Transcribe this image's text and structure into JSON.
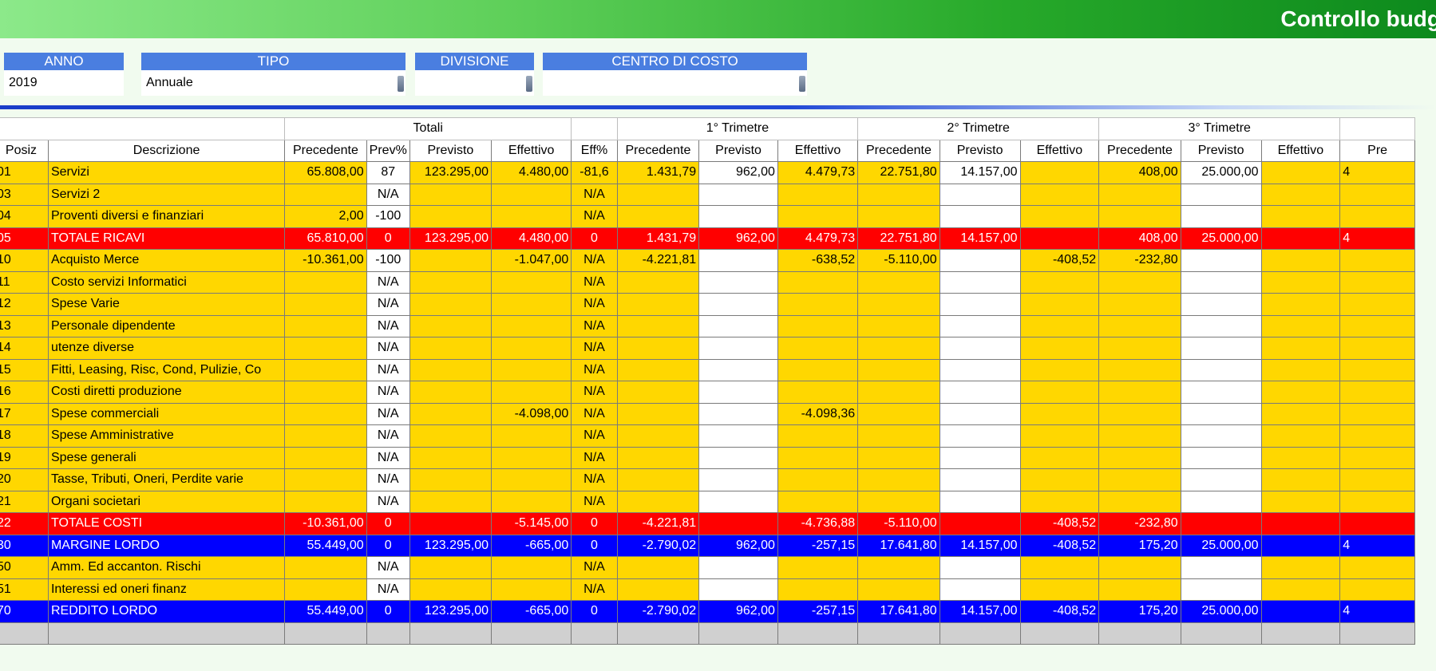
{
  "title": "Controllo budg",
  "filters": [
    {
      "label": "ANNO",
      "value": "2019"
    },
    {
      "label": "TIPO",
      "value": "Annuale"
    },
    {
      "label": "DIVISIONE",
      "value": ""
    },
    {
      "label": "CENTRO DI COSTO",
      "value": ""
    }
  ],
  "groups": [
    "Totali",
    "1° Trimetre",
    "2° Trimetre",
    "3° Trimetre"
  ],
  "columns": [
    "Posiz",
    "Descrizione",
    "Precedente",
    "Prev%",
    "Previsto",
    "Effettivo",
    "Eff%",
    "Precedente",
    "Previsto",
    "Effettivo",
    "Precedente",
    "Previsto",
    "Effettivo",
    "Precedente",
    "Previsto",
    "Effettivo",
    "Pre"
  ],
  "rows": [
    {
      "type": "yel",
      "cells": [
        "01",
        "Servizi",
        "65.808,00",
        "87",
        "123.295,00",
        "4.480,00",
        "-81,6",
        "1.431,79",
        "962,00",
        "4.479,73",
        "22.751,80",
        "14.157,00",
        "",
        "408,00",
        "25.000,00",
        "",
        "4"
      ]
    },
    {
      "type": "yel",
      "cells": [
        "03",
        "Servizi 2",
        "",
        "N/A",
        "",
        "",
        "N/A",
        "",
        "",
        "",
        "",
        "",
        "",
        "",
        "",
        "",
        ""
      ]
    },
    {
      "type": "yel",
      "cells": [
        "04",
        "Proventi diversi e finanziari",
        "2,00",
        "-100",
        "",
        "",
        "N/A",
        "",
        "",
        "",
        "",
        "",
        "",
        "",
        "",
        "",
        ""
      ]
    },
    {
      "type": "red",
      "cells": [
        "05",
        "TOTALE RICAVI",
        "65.810,00",
        "0",
        "123.295,00",
        "4.480,00",
        "0",
        "1.431,79",
        "962,00",
        "4.479,73",
        "22.751,80",
        "14.157,00",
        "",
        "408,00",
        "25.000,00",
        "",
        "4"
      ]
    },
    {
      "type": "yel",
      "cells": [
        "10",
        "Acquisto Merce",
        "-10.361,00",
        "-100",
        "",
        "-1.047,00",
        "N/A",
        "-4.221,81",
        "",
        "-638,52",
        "-5.110,00",
        "",
        "-408,52",
        "-232,80",
        "",
        "",
        ""
      ]
    },
    {
      "type": "yel",
      "cells": [
        "11",
        "Costo servizi Informatici",
        "",
        "N/A",
        "",
        "",
        "N/A",
        "",
        "",
        "",
        "",
        "",
        "",
        "",
        "",
        "",
        ""
      ]
    },
    {
      "type": "yel",
      "cells": [
        "12",
        "Spese Varie",
        "",
        "N/A",
        "",
        "",
        "N/A",
        "",
        "",
        "",
        "",
        "",
        "",
        "",
        "",
        "",
        ""
      ]
    },
    {
      "type": "yel",
      "cells": [
        "13",
        "Personale dipendente",
        "",
        "N/A",
        "",
        "",
        "N/A",
        "",
        "",
        "",
        "",
        "",
        "",
        "",
        "",
        "",
        ""
      ]
    },
    {
      "type": "yel",
      "cells": [
        "14",
        "utenze diverse",
        "",
        "N/A",
        "",
        "",
        "N/A",
        "",
        "",
        "",
        "",
        "",
        "",
        "",
        "",
        "",
        ""
      ]
    },
    {
      "type": "yel",
      "cells": [
        "15",
        "Fitti, Leasing, Risc, Cond, Pulizie, Co",
        "",
        "N/A",
        "",
        "",
        "N/A",
        "",
        "",
        "",
        "",
        "",
        "",
        "",
        "",
        "",
        ""
      ]
    },
    {
      "type": "yel",
      "cells": [
        "16",
        "Costi diretti produzione",
        "",
        "N/A",
        "",
        "",
        "N/A",
        "",
        "",
        "",
        "",
        "",
        "",
        "",
        "",
        "",
        ""
      ]
    },
    {
      "type": "yel",
      "cells": [
        "17",
        "Spese commerciali",
        "",
        "N/A",
        "",
        "-4.098,00",
        "N/A",
        "",
        "",
        "-4.098,36",
        "",
        "",
        "",
        "",
        "",
        "",
        ""
      ]
    },
    {
      "type": "yel",
      "cells": [
        "18",
        "Spese Amministrative",
        "",
        "N/A",
        "",
        "",
        "N/A",
        "",
        "",
        "",
        "",
        "",
        "",
        "",
        "",
        "",
        ""
      ]
    },
    {
      "type": "yel",
      "cells": [
        "19",
        "Spese generali",
        "",
        "N/A",
        "",
        "",
        "N/A",
        "",
        "",
        "",
        "",
        "",
        "",
        "",
        "",
        "",
        ""
      ]
    },
    {
      "type": "yel",
      "cells": [
        "20",
        "Tasse, Tributi, Oneri, Perdite varie",
        "",
        "N/A",
        "",
        "",
        "N/A",
        "",
        "",
        "",
        "",
        "",
        "",
        "",
        "",
        "",
        ""
      ]
    },
    {
      "type": "yel",
      "cells": [
        "21",
        "Organi societari",
        "",
        "N/A",
        "",
        "",
        "N/A",
        "",
        "",
        "",
        "",
        "",
        "",
        "",
        "",
        "",
        ""
      ]
    },
    {
      "type": "red",
      "cells": [
        "22",
        "TOTALE COSTI",
        "-10.361,00",
        "0",
        "",
        "-5.145,00",
        "0",
        "-4.221,81",
        "",
        "-4.736,88",
        "-5.110,00",
        "",
        "-408,52",
        "-232,80",
        "",
        "",
        ""
      ]
    },
    {
      "type": "blu",
      "cells": [
        "30",
        "MARGINE LORDO",
        "55.449,00",
        "0",
        "123.295,00",
        "-665,00",
        "0",
        "-2.790,02",
        "962,00",
        "-257,15",
        "17.641,80",
        "14.157,00",
        "-408,52",
        "175,20",
        "25.000,00",
        "",
        "4"
      ]
    },
    {
      "type": "yel",
      "cells": [
        "50",
        "Amm. Ed accanton. Rischi",
        "",
        "N/A",
        "",
        "",
        "N/A",
        "",
        "",
        "",
        "",
        "",
        "",
        "",
        "",
        "",
        ""
      ]
    },
    {
      "type": "yel",
      "cells": [
        "51",
        "Interessi ed oneri finanz",
        "",
        "N/A",
        "",
        "",
        "N/A",
        "",
        "",
        "",
        "",
        "",
        "",
        "",
        "",
        "",
        ""
      ]
    },
    {
      "type": "blu",
      "cells": [
        "70",
        "REDDITO LORDO",
        "55.449,00",
        "0",
        "123.295,00",
        "-665,00",
        "0",
        "-2.790,02",
        "962,00",
        "-257,15",
        "17.641,80",
        "14.157,00",
        "-408,52",
        "175,20",
        "25.000,00",
        "",
        "4"
      ]
    },
    {
      "type": "gray",
      "cells": [
        "",
        "",
        "",
        "",
        "",
        "",
        "",
        "",
        "",
        "",
        "",
        "",
        "",
        "",
        "",
        "",
        ""
      ]
    }
  ],
  "colors": {
    "yellow": "#ffd700",
    "red": "#ff0000",
    "blue": "#0000ff",
    "header_blue": "#4a7ee0"
  }
}
